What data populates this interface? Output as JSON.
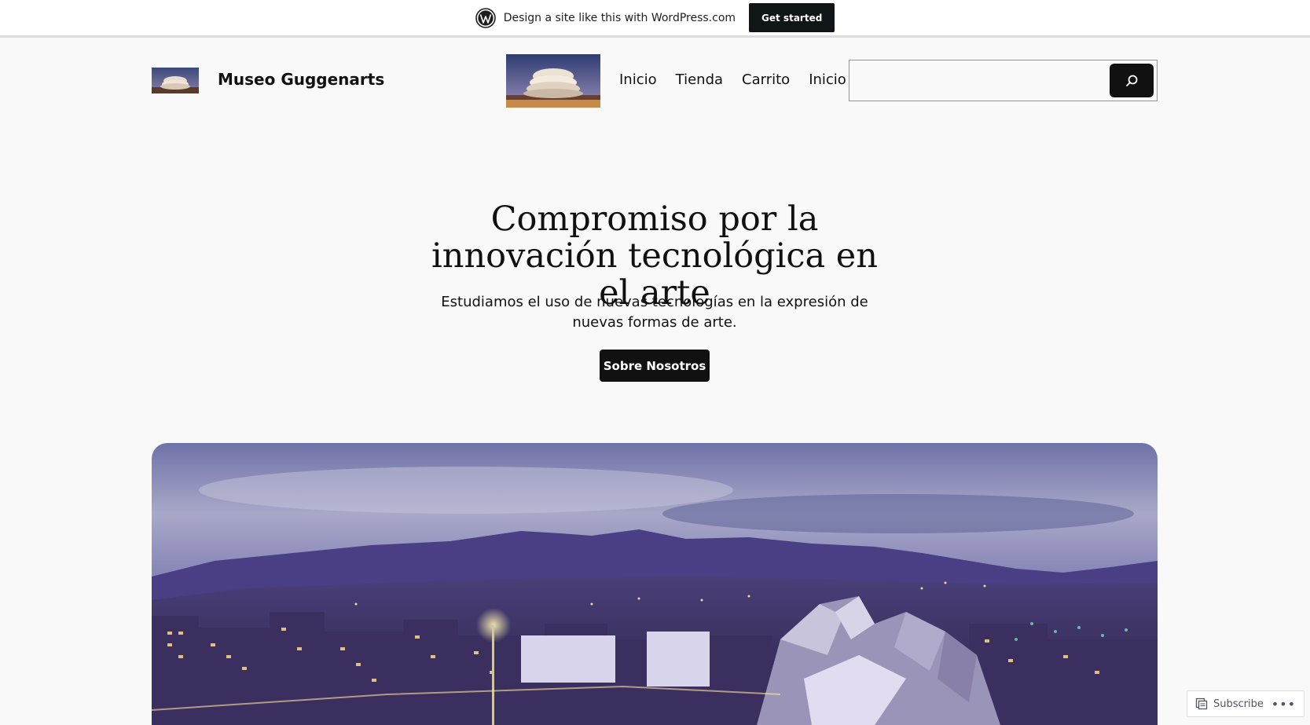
{
  "wp_banner": {
    "logo_icon": "wordpress-logo-icon",
    "text": "Design a site like this with WordPress.com",
    "cta_label": "Get started"
  },
  "header": {
    "site_title": "Museo Guggenarts",
    "nav": [
      {
        "label": "Inicio"
      },
      {
        "label": "Tienda"
      },
      {
        "label": "Carrito"
      },
      {
        "label": "Inicio"
      }
    ],
    "search": {
      "value": "",
      "icon": "search-icon"
    }
  },
  "hero": {
    "heading": "Compromiso por la innovación tecnológica en el arte",
    "subtitle": "Estudiamos el uso de nuevas tecnologías en la expresión de nuevas formas de arte.",
    "button_label": "Sobre Nosotros"
  },
  "subscribe_widget": {
    "icon": "reader-icon",
    "label": "Subscribe",
    "more_label": "•••"
  },
  "colors": {
    "background": "#f9f9f9",
    "primary": "#111111",
    "banner_bg": "#ffffff"
  }
}
